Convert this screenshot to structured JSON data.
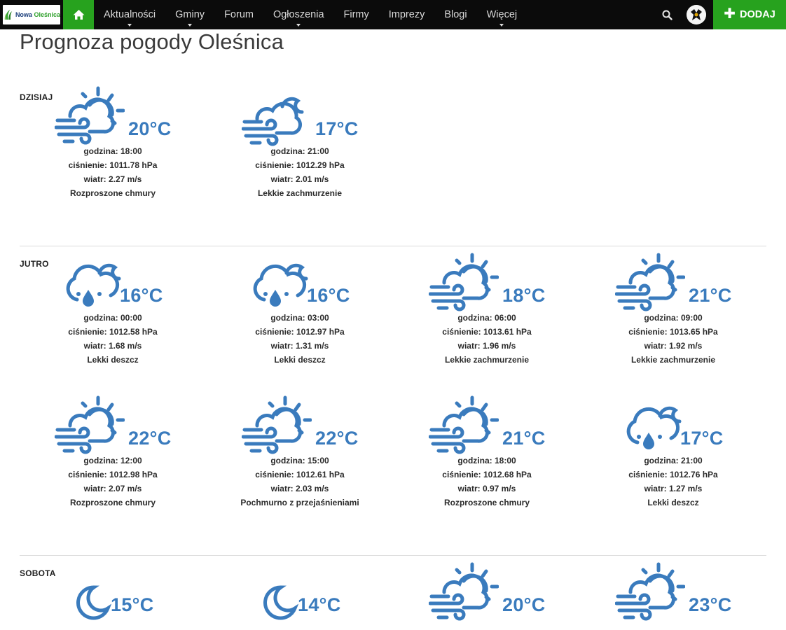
{
  "nav": {
    "logo": {
      "main_1": "Nowa",
      "main_2": "Oleśnica"
    },
    "items": [
      {
        "label": "Aktualności",
        "dropdown": true
      },
      {
        "label": "Gminy",
        "dropdown": true
      },
      {
        "label": "Forum",
        "dropdown": false
      },
      {
        "label": "Ogłoszenia",
        "dropdown": true
      },
      {
        "label": "Firmy",
        "dropdown": false
      },
      {
        "label": "Imprezy",
        "dropdown": false
      },
      {
        "label": "Blogi",
        "dropdown": false
      },
      {
        "label": "Więcej",
        "dropdown": true
      }
    ],
    "add_label": "DODAJ",
    "icons": {
      "home": "home-icon",
      "search": "search-icon",
      "avatar": "avatar",
      "add": "plus-icon"
    }
  },
  "page": {
    "title": "Prognoza pogody Oleśnica"
  },
  "labels": {
    "hour": "godzina: ",
    "pressure": "ciśnienie: ",
    "wind": "wiatr: "
  },
  "colors": {
    "nav_bg": "#0b0b0b",
    "accent_green": "#27a21e",
    "icon_blue": "#3a7bbd"
  },
  "sections": [
    {
      "label": "DZISIAJ",
      "forecasts": [
        {
          "icon": "wind-sun-cloud",
          "temp": "20°C",
          "hour": "18:00",
          "pressure": "1011.78 hPa",
          "wind": "2.27 m/s",
          "desc": "Rozproszone chmury"
        },
        {
          "icon": "wind-cloud-moon",
          "temp": "17°C",
          "hour": "21:00",
          "pressure": "1012.29 hPa",
          "wind": "2.01 m/s",
          "desc": "Lekkie zachmurzenie"
        }
      ]
    },
    {
      "label": "JUTRO",
      "forecasts": [
        {
          "icon": "rain-cloud-moon",
          "temp": "16°C",
          "hour": "00:00",
          "pressure": "1012.58 hPa",
          "wind": "1.68 m/s",
          "desc": "Lekki deszcz"
        },
        {
          "icon": "rain-cloud-moon",
          "temp": "16°C",
          "hour": "03:00",
          "pressure": "1012.97 hPa",
          "wind": "1.31 m/s",
          "desc": "Lekki deszcz"
        },
        {
          "icon": "wind-sun-cloud",
          "temp": "18°C",
          "hour": "06:00",
          "pressure": "1013.61 hPa",
          "wind": "1.96 m/s",
          "desc": "Lekkie zachmurzenie"
        },
        {
          "icon": "wind-sun-cloud",
          "temp": "21°C",
          "hour": "09:00",
          "pressure": "1013.65 hPa",
          "wind": "1.92 m/s",
          "desc": "Lekkie zachmurzenie"
        },
        {
          "icon": "wind-sun-cloud",
          "temp": "22°C",
          "hour": "12:00",
          "pressure": "1012.98 hPa",
          "wind": "2.07 m/s",
          "desc": "Rozproszone chmury"
        },
        {
          "icon": "wind-sun-cloud",
          "temp": "22°C",
          "hour": "15:00",
          "pressure": "1012.61 hPa",
          "wind": "2.03 m/s",
          "desc": "Pochmurno z przejaśnieniami"
        },
        {
          "icon": "wind-sun-cloud",
          "temp": "21°C",
          "hour": "18:00",
          "pressure": "1012.68 hPa",
          "wind": "0.97 m/s",
          "desc": "Rozproszone chmury"
        },
        {
          "icon": "rain-cloud-moon",
          "temp": "17°C",
          "hour": "21:00",
          "pressure": "1012.76 hPa",
          "wind": "1.27 m/s",
          "desc": "Lekki deszcz"
        }
      ]
    },
    {
      "label": "SOBOTA",
      "forecasts": [
        {
          "icon": "moon",
          "temp": "15°C"
        },
        {
          "icon": "moon",
          "temp": "14°C"
        },
        {
          "icon": "wind-sun-cloud",
          "temp": "20°C"
        },
        {
          "icon": "wind-sun-cloud",
          "temp": "23°C"
        }
      ]
    }
  ]
}
